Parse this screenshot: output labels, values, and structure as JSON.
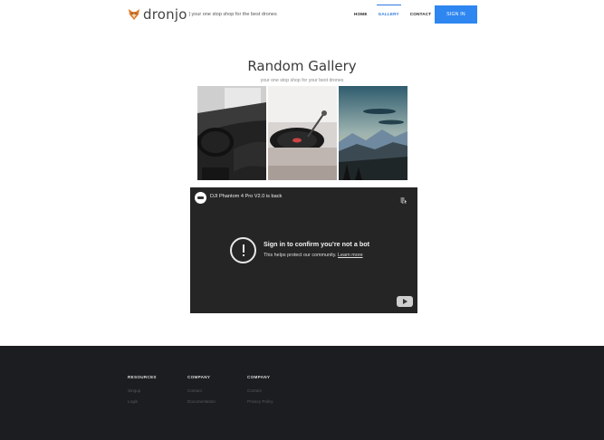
{
  "header": {
    "logo_name": "dronjo",
    "tagline": "| your one stop shop for the best drones",
    "nav": [
      "HOME",
      "GALLERY",
      "CONTACT"
    ],
    "active_nav": "GALLERY",
    "signin_label": "SIGN IN",
    "accent": "#2e86f0"
  },
  "gallery": {
    "title": "Random Gallery",
    "subtitle": "your one stop shop for your best drones",
    "photos": [
      "car-interior-photo",
      "record-player-photo",
      "mountain-landscape-photo"
    ]
  },
  "video": {
    "title": "DJI Phantom 4 Pro V2.0 is back",
    "count": "1/1",
    "heading": "Sign in to confirm you’re not a bot",
    "message": "This helps protect our community.",
    "link": "Learn more"
  },
  "footer": {
    "columns": [
      {
        "heading": "RESOURCES",
        "links": [
          "Singup",
          "Login"
        ]
      },
      {
        "heading": "COMPANY",
        "links": [
          "Contact",
          "Documentation"
        ]
      },
      {
        "heading": "COMPANY",
        "links": [
          "Contact",
          "Privacy Policy"
        ]
      }
    ],
    "background": "#1c1d20"
  }
}
